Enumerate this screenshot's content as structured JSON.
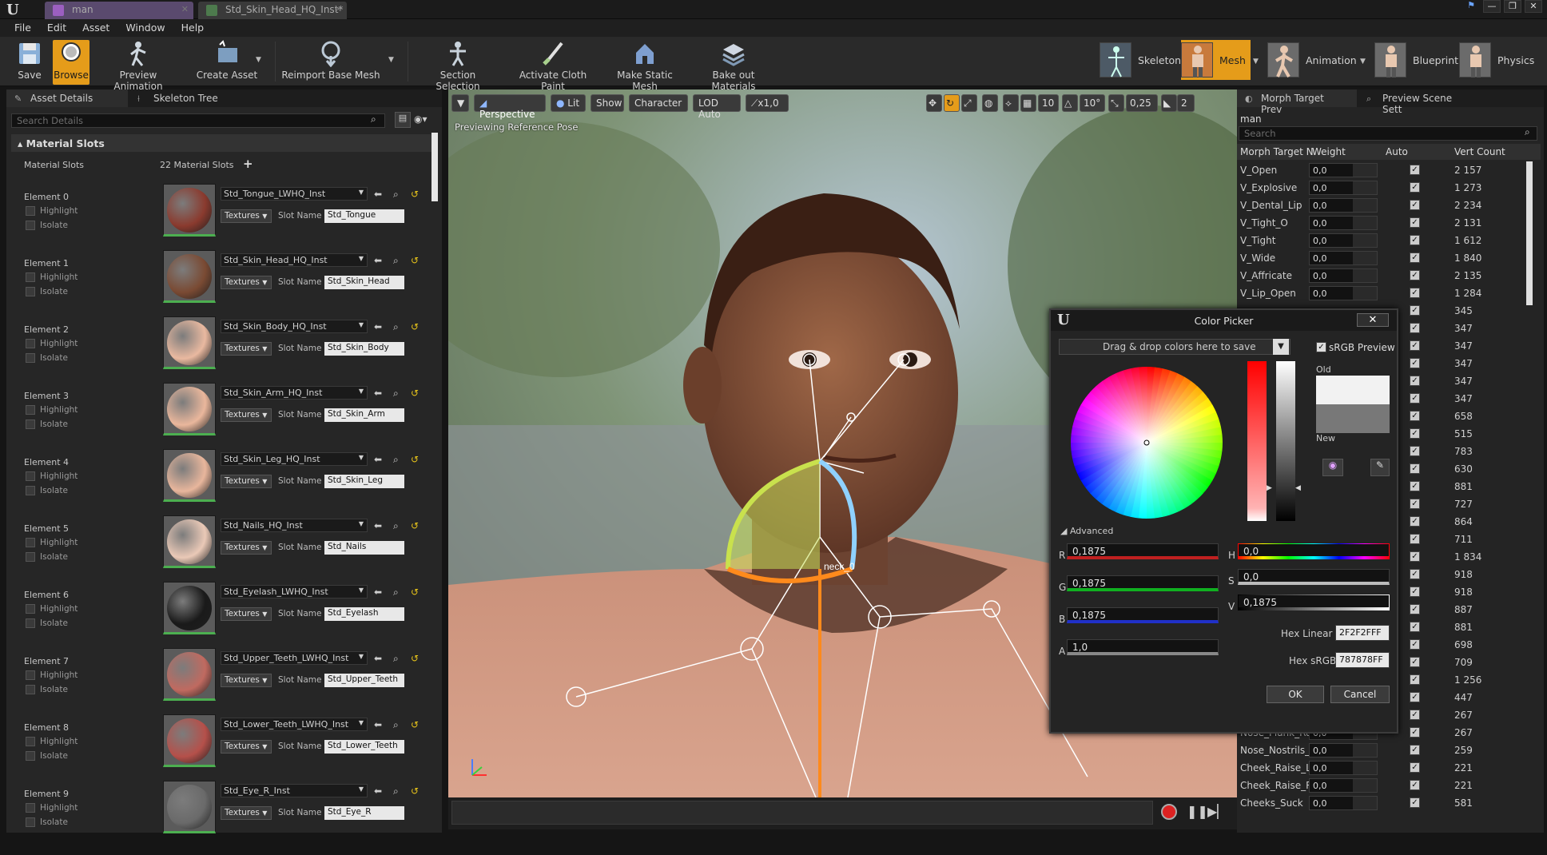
{
  "titlebar": {
    "tabs": [
      {
        "label": "man",
        "icon": "skeletal-mesh-icon"
      },
      {
        "label": "Std_Skin_Head_HQ_Inst*",
        "icon": "material-instance-icon"
      }
    ]
  },
  "menu": [
    "File",
    "Edit",
    "Asset",
    "Window",
    "Help"
  ],
  "toolbar": {
    "save": "Save",
    "browse": "Browse",
    "preview_animation": "Preview Animation",
    "create_asset": "Create Asset",
    "reimport": "Reimport Base Mesh",
    "section_selection": "Section Selection",
    "activate_cloth_paint": "Activate Cloth Paint",
    "make_static_mesh": "Make Static Mesh",
    "bake_out_materials": "Bake out Materials",
    "modes": [
      "Skeleton",
      "Mesh",
      "Animation",
      "Blueprint",
      "Physics"
    ]
  },
  "left_panel": {
    "tabs": [
      "Asset Details",
      "Skeleton Tree"
    ],
    "search_placeholder": "Search Details",
    "section": "Material Slots",
    "material_slots_label": "Material Slots",
    "slots_count": "22 Material Slots",
    "highlight": "Highlight",
    "isolate": "Isolate",
    "textures": "Textures",
    "slot_name_label": "Slot Name",
    "elements": [
      {
        "label": "Element 0",
        "material": "Std_Tongue_LWHQ_Inst",
        "slot": "Std_Tongue",
        "color": "#8a3a2e"
      },
      {
        "label": "Element 1",
        "material": "Std_Skin_Head_HQ_Inst",
        "slot": "Std_Skin_Head",
        "color": "#7a4a33"
      },
      {
        "label": "Element 2",
        "material": "Std_Skin_Body_HQ_Inst",
        "slot": "Std_Skin_Body",
        "color": "#e9b9a0"
      },
      {
        "label": "Element 3",
        "material": "Std_Skin_Arm_HQ_Inst",
        "slot": "Std_Skin_Arm",
        "color": "#eab79c"
      },
      {
        "label": "Element 4",
        "material": "Std_Skin_Leg_HQ_Inst",
        "slot": "Std_Skin_Leg",
        "color": "#e8b69c"
      },
      {
        "label": "Element 5",
        "material": "Std_Nails_HQ_Inst",
        "slot": "Std_Nails",
        "color": "#eac9b7"
      },
      {
        "label": "Element 6",
        "material": "Std_Eyelash_LWHQ_Inst",
        "slot": "Std_Eyelash",
        "color": "#1a1a1a"
      },
      {
        "label": "Element 7",
        "material": "Std_Upper_Teeth_LWHQ_Inst",
        "slot": "Std_Upper_Teeth",
        "color": "#c06a60"
      },
      {
        "label": "Element 8",
        "material": "Std_Lower_Teeth_LWHQ_Inst",
        "slot": "Std_Lower_Teeth",
        "color": "#b5504a"
      },
      {
        "label": "Element 9",
        "material": "Std_Eye_R_Inst",
        "slot": "Std_Eye_R",
        "color": "#6a6a6a"
      }
    ]
  },
  "viewport": {
    "dropdown": "▼",
    "perspective": "Perspective",
    "lit": "Lit",
    "show": "Show",
    "character": "Character",
    "lod": "LOD Auto",
    "speed": "x1,0",
    "grid_snap": "10",
    "rot_snap": "10°",
    "scale_snap": "0,25",
    "cam_speed": "2",
    "status": "Previewing Reference Pose",
    "bone_label": "neck_0"
  },
  "right_panel": {
    "tabs": [
      "Morph Target Prev",
      "Preview Scene Sett"
    ],
    "asset": "man",
    "search_placeholder": "Search",
    "columns": [
      "Morph Target N",
      "Weight",
      "Auto",
      "Vert Count"
    ],
    "rows_top": [
      {
        "name": "V_Open",
        "weight": "0,0",
        "count": "2 157"
      },
      {
        "name": "V_Explosive",
        "weight": "0,0",
        "count": "1 273"
      },
      {
        "name": "V_Dental_Lip",
        "weight": "0,0",
        "count": "2 234"
      },
      {
        "name": "V_Tight_O",
        "weight": "0,0",
        "count": "2 131"
      },
      {
        "name": "V_Tight",
        "weight": "0,0",
        "count": "1 612"
      },
      {
        "name": "V_Wide",
        "weight": "0,0",
        "count": "1 840"
      },
      {
        "name": "V_Affricate",
        "weight": "0,0",
        "count": "2 135"
      },
      {
        "name": "V_Lip_Open",
        "weight": "0,0",
        "count": "1 284"
      }
    ],
    "counts_mid": [
      "345",
      "347",
      "347",
      "347",
      "347",
      "347",
      "658",
      "515",
      "783",
      "630",
      "881",
      "727",
      "864",
      "711",
      "1 834",
      "918",
      "918",
      "887",
      "881",
      "698",
      "709",
      "1 256",
      "447",
      "267"
    ],
    "rows_bottom": [
      {
        "name": "Nose_Flank_Rais",
        "weight": "0,0",
        "count": "267"
      },
      {
        "name": "Nose_Nostrils_Fl",
        "weight": "0,0",
        "count": "259"
      },
      {
        "name": "Cheek_Raise_L",
        "weight": "0,0",
        "count": "221"
      },
      {
        "name": "Cheek_Raise_R",
        "weight": "0,0",
        "count": "221"
      },
      {
        "name": "Cheeks_Suck",
        "weight": "0,0",
        "count": "581"
      }
    ]
  },
  "color_picker": {
    "title": "Color Picker",
    "close": "✕",
    "swatch_bar": "Drag & drop colors here to save",
    "srgb_preview": "sRGB Preview",
    "old": "Old",
    "new": "New",
    "advanced": "Advanced",
    "r_label": "R",
    "r": "0,1875",
    "g_label": "G",
    "g": "0,1875",
    "b_label": "B",
    "b": "0,1875",
    "a_label": "A",
    "a": "1,0",
    "h_label": "H",
    "h": "0,0",
    "s_label": "S",
    "s": "0,0",
    "v_label": "V",
    "v": "0,1875",
    "hex_linear_label": "Hex Linear",
    "hex_linear": "2F2F2FFF",
    "hex_srgb_label": "Hex sRGB",
    "hex_srgb": "787878FF",
    "ok": "OK",
    "cancel": "Cancel"
  },
  "colors": {
    "accent": "#e59c1a",
    "panel": "#262626",
    "old_color": "#f2f2f2",
    "new_color": "#787878"
  }
}
